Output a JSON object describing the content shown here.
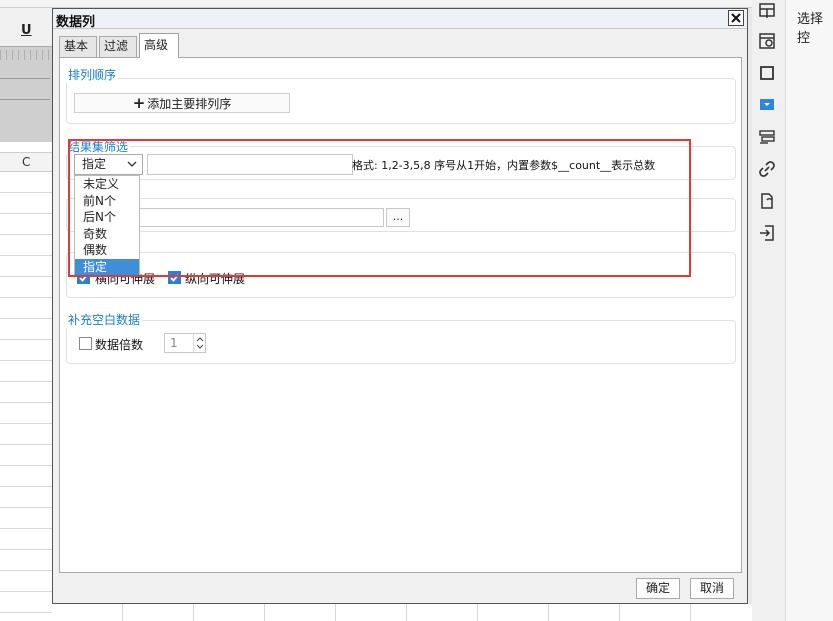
{
  "dialog": {
    "title": "数据列",
    "tabs": [
      {
        "label": "基本"
      },
      {
        "label": "过滤"
      },
      {
        "label": "高级"
      }
    ],
    "sort": {
      "group_label": "排列顺序",
      "add_button": "添加主要排列序"
    },
    "filter": {
      "group_label": "结果集筛选",
      "selected": "指定",
      "input_value": "",
      "hint": "格式: 1,2-3,5,8 序号从1开始，内置参数$__count__表示总数",
      "options": [
        "未定义",
        "前N个",
        "后N个",
        "奇数",
        "偶数",
        "指定"
      ]
    },
    "expand": {
      "horizontal_label": "横向可伸展",
      "vertical_label": "纵向可伸展"
    },
    "blank": {
      "group_label": "补充空白数据",
      "checkbox_label": "数据倍数",
      "spinner_value": "1"
    },
    "ok_label": "确定",
    "cancel_label": "取消",
    "dots_label": "..."
  },
  "right_panel": {
    "label": "选择控"
  },
  "background": {
    "underline_button": "U",
    "column_header": "C"
  },
  "colors": {
    "accent": "#1a7fc8",
    "highlight": "#e03a3a",
    "selected": "#3e8ed8"
  }
}
